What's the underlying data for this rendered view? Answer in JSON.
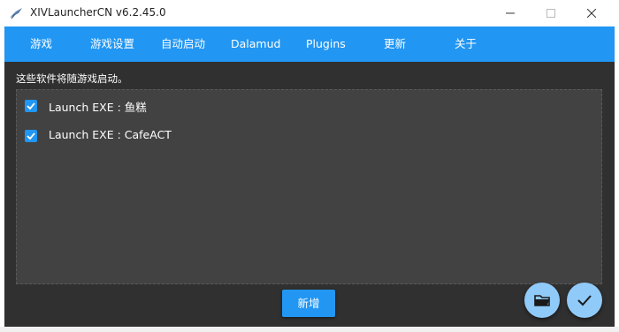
{
  "window": {
    "title": "XIVLauncherCN v6.2.45.0"
  },
  "nav": {
    "items": [
      {
        "label": "游戏"
      },
      {
        "label": "游戏设置"
      },
      {
        "label": "自动启动"
      },
      {
        "label": "Dalamud"
      },
      {
        "label": "Plugins"
      },
      {
        "label": "更新"
      },
      {
        "label": "关于"
      }
    ]
  },
  "autostart": {
    "hint": "这些软件将随游戏启动。",
    "items": [
      {
        "label": "Launch EXE : 鱼糕",
        "checked": true
      },
      {
        "label": "Launch EXE : CafeACT",
        "checked": true
      }
    ],
    "add_label": "新增"
  },
  "colors": {
    "accent": "#2196f3",
    "fab": "#90caf9",
    "panel": "#303030",
    "list": "#424242"
  },
  "icons": {
    "app": "xiv-launcher-icon",
    "minimize": "minimize-icon",
    "maximize": "maximize-icon",
    "close": "close-icon",
    "checkbox": "checkmark-icon",
    "folder": "folder-icon",
    "confirm": "checkmark-icon"
  }
}
